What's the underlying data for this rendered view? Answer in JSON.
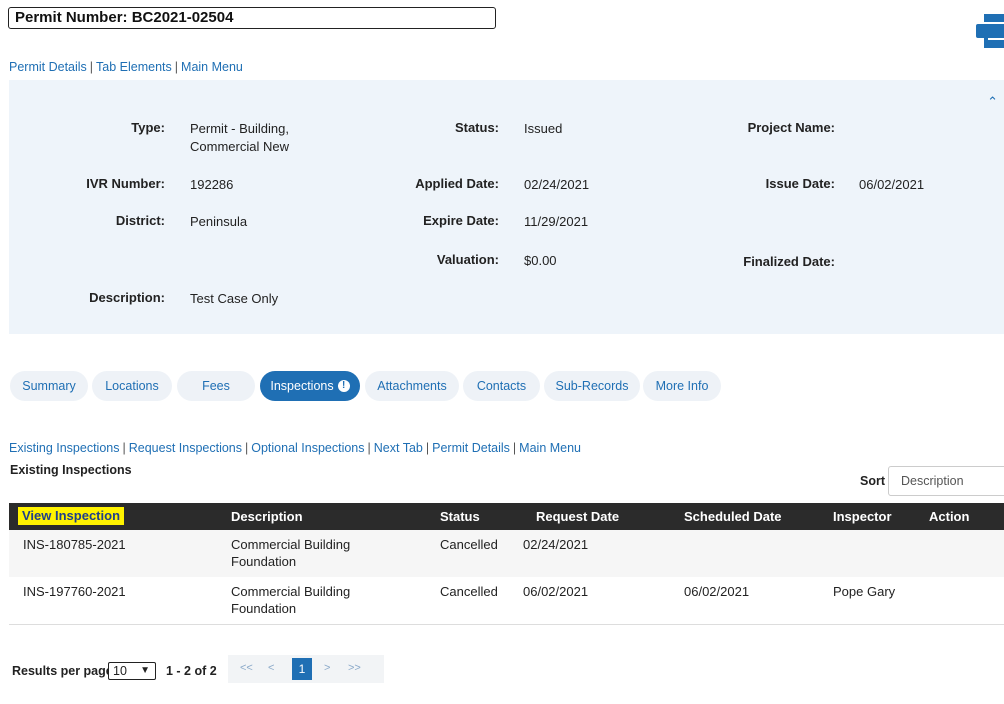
{
  "header": {
    "permit_number": "Permit Number: BC2021-02504",
    "links": [
      "Permit Details",
      "Tab Elements",
      "Main Menu"
    ]
  },
  "details": {
    "type_label": "Type:",
    "type_value_line1": "Permit - Building,",
    "type_value_line2": "Commercial New",
    "status_label": "Status:",
    "status_value": "Issued",
    "project_name_label": "Project Name:",
    "ivr_label": "IVR Number:",
    "ivr_value": "192286",
    "applied_label": "Applied Date:",
    "applied_value": "02/24/2021",
    "issue_label": "Issue Date:",
    "issue_value": "06/02/2021",
    "district_label": "District:",
    "district_value": "Peninsula",
    "expire_label": "Expire Date:",
    "expire_value": "11/29/2021",
    "valuation_label": "Valuation:",
    "valuation_value": "$0.00",
    "finalized_label": "Finalized Date:",
    "description_label": "Description:",
    "description_value": "Test Case Only"
  },
  "tabs": [
    "Summary",
    "Locations",
    "Fees",
    "Inspections",
    "Attachments",
    "Contacts",
    "Sub-Records",
    "More Info"
  ],
  "active_tab": "Inspections",
  "sub_links": [
    "Existing Inspections",
    "Request Inspections",
    "Optional Inspections",
    "Next Tab",
    "Permit Details",
    "Main Menu"
  ],
  "section_title": "Existing Inspections",
  "sort": {
    "label": "Sort",
    "value": "Description"
  },
  "table": {
    "headers": [
      "View Inspection",
      "Description",
      "Status",
      "Request Date",
      "Scheduled Date",
      "Inspector",
      "Action"
    ],
    "rows": [
      {
        "id": "INS-180785-2021",
        "desc1": "Commercial Building",
        "desc2": "Foundation",
        "status": "Cancelled",
        "request_date": "02/24/2021",
        "scheduled_date": "",
        "inspector": ""
      },
      {
        "id": "INS-197760-2021",
        "desc1": "Commercial Building",
        "desc2": "Foundation",
        "status": "Cancelled",
        "request_date": "06/02/2021",
        "scheduled_date": "06/02/2021",
        "inspector": "Pope Gary"
      }
    ]
  },
  "pager": {
    "label": "Results per page",
    "per_page": "10",
    "range": "1 - 2 of 2",
    "first": "<<",
    "prev": "<",
    "current": "1",
    "next": ">",
    "last": ">>"
  },
  "colors": {
    "accent": "#1f6fb4",
    "panel": "#eef4fa",
    "header_bg": "#2b2b2b",
    "highlight": "#fff200"
  }
}
